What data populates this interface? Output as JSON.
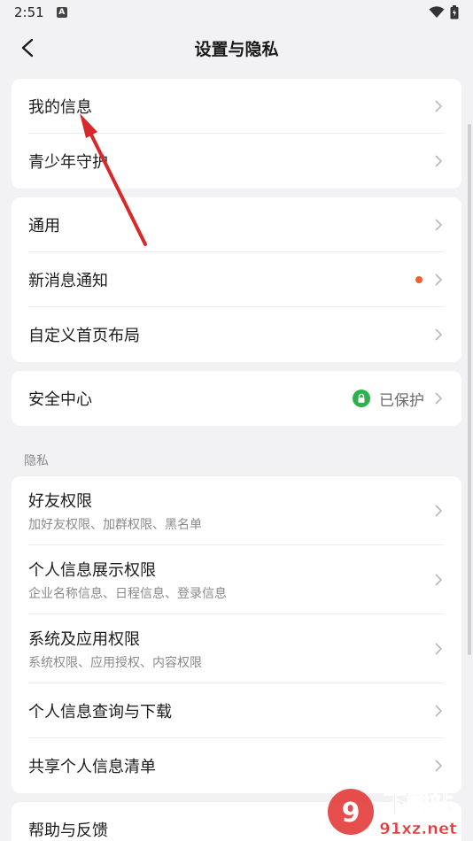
{
  "status": {
    "time": "2:51",
    "a_badge": "A"
  },
  "nav": {
    "title": "设置与隐私"
  },
  "cards": [
    {
      "items": [
        {
          "label": "我的信息"
        },
        {
          "label": "青少年守护"
        }
      ]
    },
    {
      "items": [
        {
          "label": "通用"
        },
        {
          "label": "新消息通知"
        },
        {
          "label": "自定义首页布局"
        }
      ]
    },
    {
      "items": [
        {
          "label": "安全中心",
          "status": "已保护"
        }
      ]
    }
  ],
  "privacy": {
    "section_label": "隐私",
    "items": [
      {
        "label": "好友权限",
        "sub": "加好友权限、加群权限、黑名单"
      },
      {
        "label": "个人信息展示权限",
        "sub": "企业名称信息、日程信息、登录信息"
      },
      {
        "label": "系统及应用权限",
        "sub": "系统权限、应用授权、内容权限"
      },
      {
        "label": "个人信息查询与下载"
      },
      {
        "label": "共享个人信息清单"
      }
    ]
  },
  "help": {
    "label": "帮助与反馈"
  },
  "watermark": {
    "brand": "下载站",
    "domain": "91xz.net"
  },
  "colors": {
    "accent_dot": "#f2612b",
    "protected_green": "#2cb24c",
    "arrow": "#d8282a"
  }
}
